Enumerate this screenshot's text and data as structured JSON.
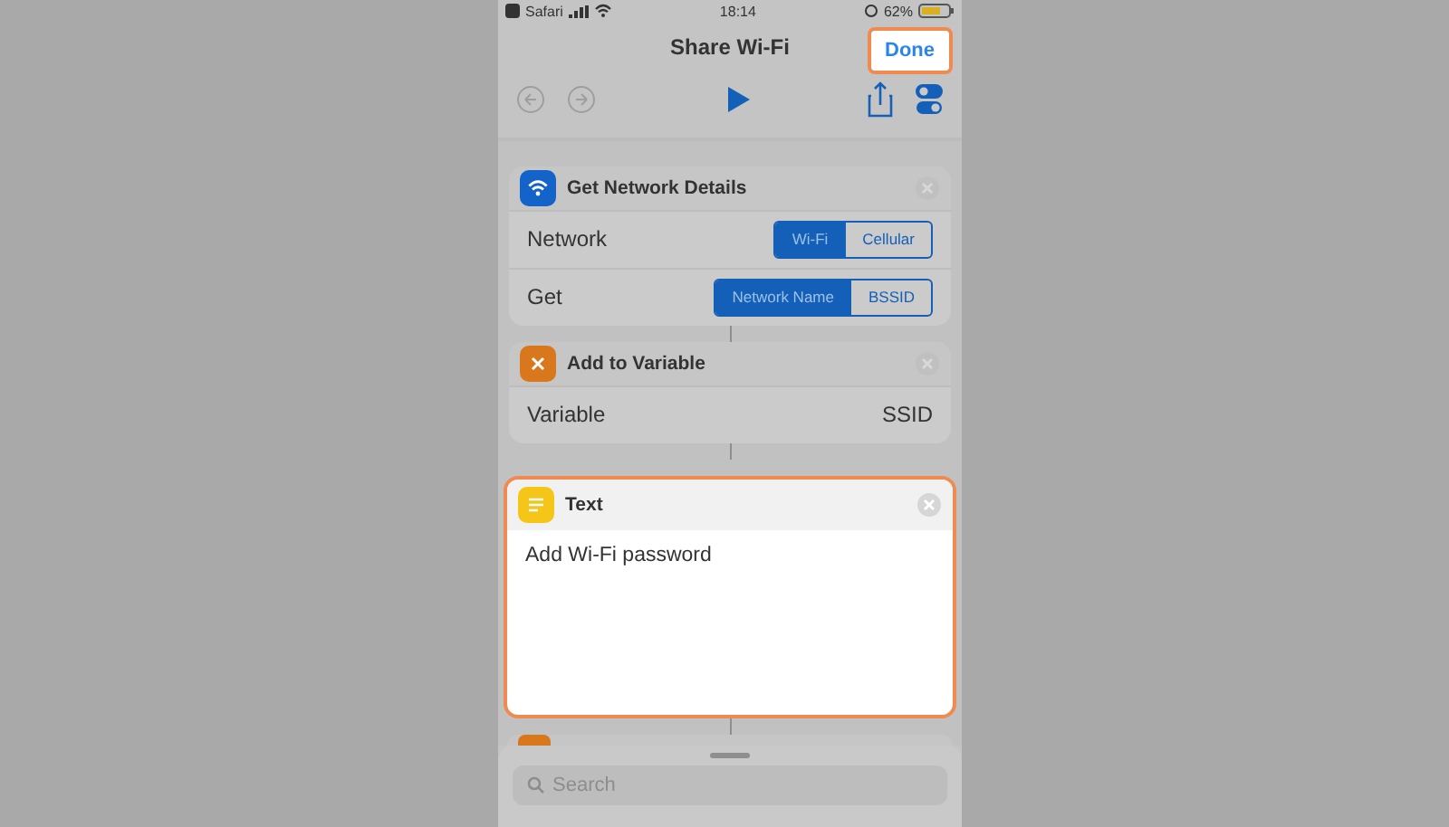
{
  "status_bar": {
    "carrier": "Safari",
    "time": "18:14",
    "battery": "62%"
  },
  "nav": {
    "title": "Share Wi-Fi",
    "done": {
      "label": "Done",
      "highlighted": true
    }
  },
  "actions": [
    {
      "title": "Get Network Details",
      "kind": "wifi",
      "color": "#1463c8",
      "highlighted": false,
      "rows": [
        {
          "kind": "segments",
          "label": "Network",
          "segments": [
            {
              "label": "Wi-Fi",
              "selected": true
            },
            {
              "label": "Cellular",
              "selected": false
            }
          ]
        },
        {
          "kind": "segments",
          "label": "Get",
          "segments": [
            {
              "label": "Network Name",
              "selected": true
            },
            {
              "label": "BSSID",
              "selected": false
            }
          ]
        }
      ]
    },
    {
      "title": "Add to Variable",
      "kind": "variable",
      "color": "#d9771c",
      "highlighted": false,
      "rows": [
        {
          "kind": "value",
          "label": "Variable",
          "value": "SSID"
        }
      ]
    },
    {
      "title": "Text",
      "kind": "text",
      "color": "#f5c518",
      "highlighted": true,
      "body": "Add Wi-Fi password"
    }
  ],
  "search": {
    "placeholder": "Search"
  }
}
